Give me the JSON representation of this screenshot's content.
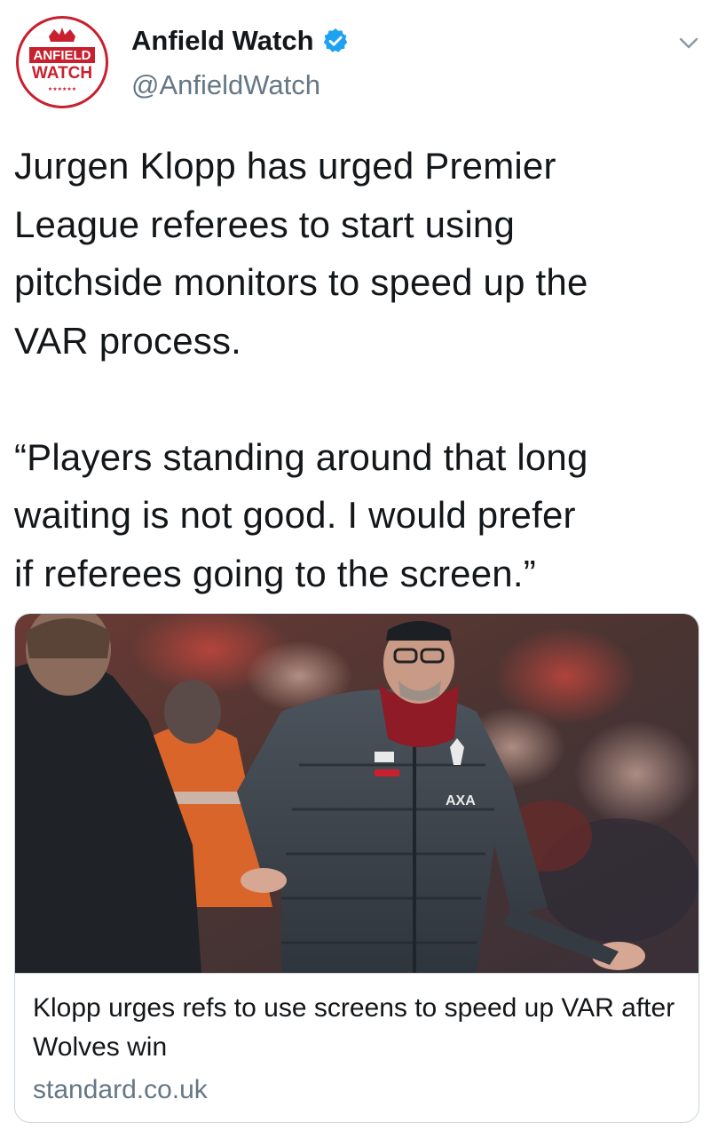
{
  "author": {
    "display_name": "Anfield Watch",
    "handle": "@AnfieldWatch",
    "avatar_text_top": "ANFIELD",
    "avatar_text_bottom": "WATCH",
    "avatar_stars": "★★★★★★",
    "verified": true
  },
  "tweet": {
    "text": "Jurgen Klopp has urged Premier\nLeague referees to start using\npitchside monitors to speed up the\nVAR process.\n\n“Players standing around that long\nwaiting is not good. I would prefer\nif referees going to the screen.”"
  },
  "link_card": {
    "title": "Klopp urges refs to use screens to speed up VAR after Wolves win",
    "domain": "standard.co.uk",
    "image_icon": "photo-klopp-touchline"
  },
  "icons": {
    "verified": "verified-badge-icon",
    "menu": "chevron-down-icon"
  },
  "colors": {
    "brand_red": "#c8202f",
    "verified_blue": "#1da1f2",
    "secondary_text": "#657786",
    "border": "#ccd6dd"
  }
}
